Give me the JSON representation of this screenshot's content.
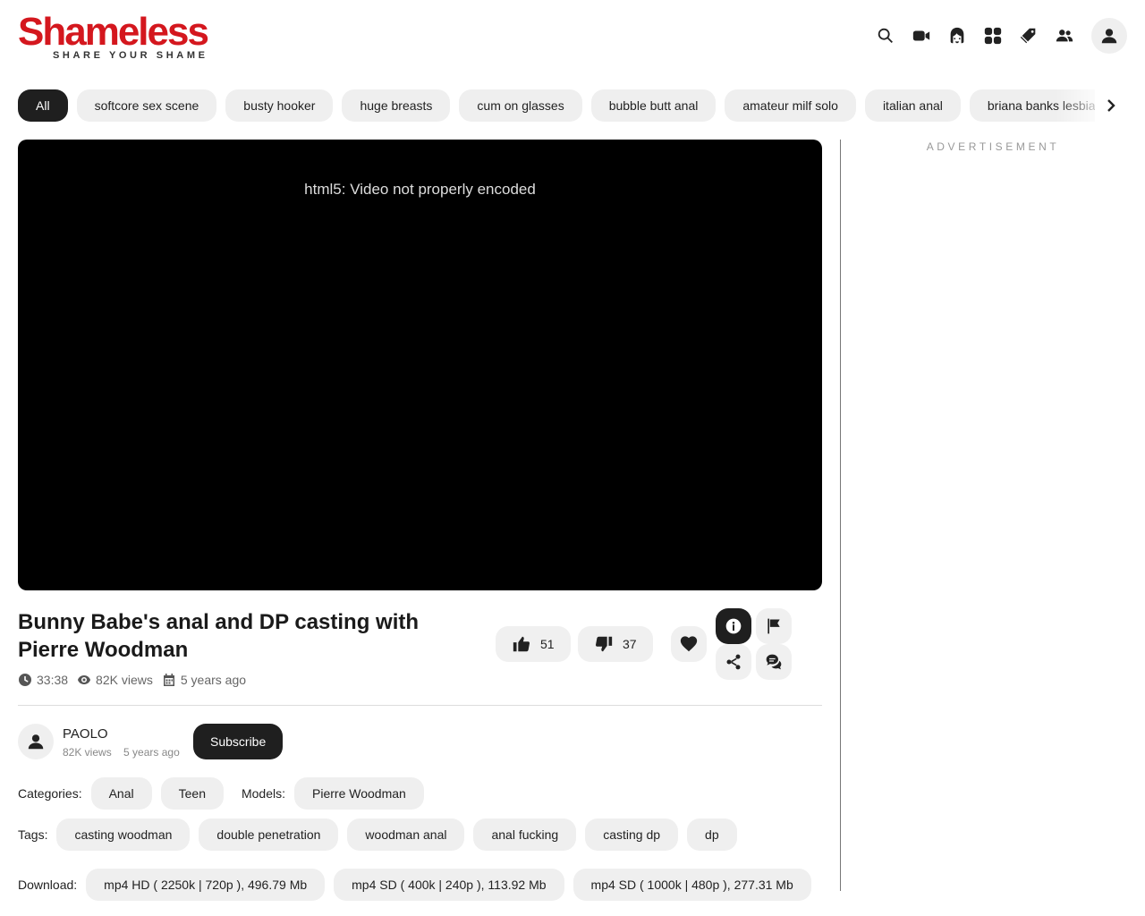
{
  "brand": {
    "logo_text": "Shameless",
    "tagline": "SHARE YOUR SHAME"
  },
  "nav": {
    "icons": [
      "search-icon",
      "video-camera-icon",
      "girl-face-icon",
      "grid-categories-icon",
      "tags-icon",
      "users-icon"
    ],
    "account_icon": "user-icon"
  },
  "chips": [
    {
      "label": "All"
    },
    {
      "label": "softcore sex scene"
    },
    {
      "label": "busty hooker"
    },
    {
      "label": "huge breasts"
    },
    {
      "label": "cum on glasses"
    },
    {
      "label": "bubble butt anal"
    },
    {
      "label": "amateur milf solo"
    },
    {
      "label": "italian anal"
    },
    {
      "label": "briana banks lesbian"
    }
  ],
  "player": {
    "message": "html5: Video not properly encoded"
  },
  "sidebar": {
    "ad_label": "ADVERTISEMENT"
  },
  "video": {
    "title": "Bunny Babe's anal and DP casting with Pierre Woodman",
    "duration": "33:38",
    "views": "82K views",
    "age": "5 years ago",
    "likes": "51",
    "dislikes": "37"
  },
  "uploader": {
    "name": "PAOLO",
    "views": "82K views",
    "age": "5 years ago",
    "subscribe_label": "Subscribe"
  },
  "categories": {
    "label": "Categories:",
    "items": [
      "Anal",
      "Teen"
    ]
  },
  "models": {
    "label": "Models:",
    "items": [
      "Pierre Woodman"
    ]
  },
  "tags": {
    "label": "Tags:",
    "items": [
      "casting woodman",
      "double penetration",
      "woodman anal",
      "anal fucking",
      "casting dp",
      "dp"
    ]
  },
  "download": {
    "label": "Download:",
    "items": [
      "mp4 HD ( 2250k | 720p ), 496.79 Mb",
      "mp4 SD ( 400k | 240p ), 113.92 Mb",
      "mp4 SD ( 1000k | 480p ), 277.31 Mb"
    ]
  }
}
